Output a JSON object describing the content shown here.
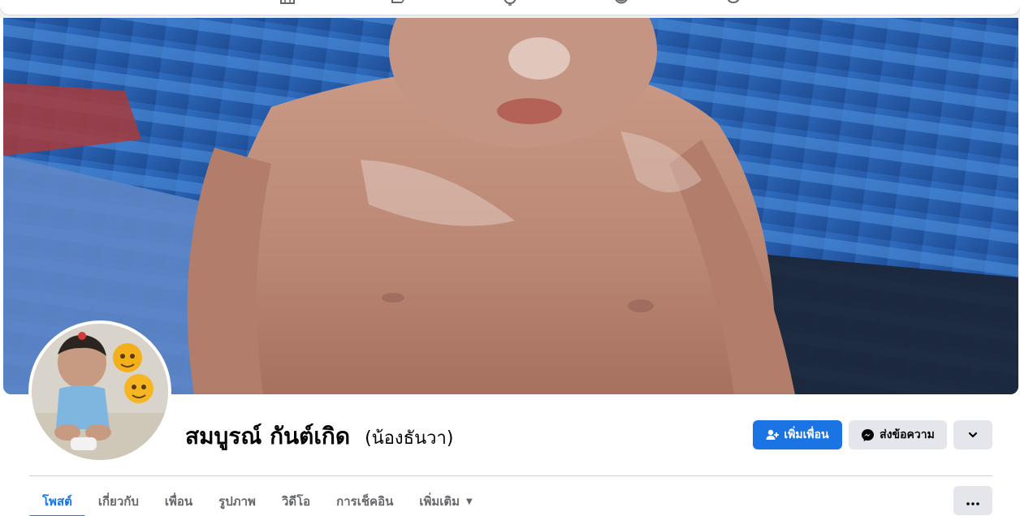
{
  "topnav": {
    "icons": [
      "home-icon",
      "pages-icon",
      "video-icon",
      "groups-icon",
      "gaming-icon"
    ]
  },
  "profile": {
    "name": "สมบูรณ์ กันต์เกิด",
    "nickname": "(น้องธันวา)",
    "cover_alt": "cover-photo",
    "avatar_alt": "profile-picture"
  },
  "actions": {
    "add_friend_label": "เพิ่มเพื่อน",
    "message_label": "ส่งข้อความ",
    "more_icon": "chevron-down-icon"
  },
  "tabs": [
    {
      "label": "โพสต์",
      "active": true
    },
    {
      "label": "เกี่ยวกับ",
      "active": false
    },
    {
      "label": "เพื่อน",
      "active": false
    },
    {
      "label": "รูปภาพ",
      "active": false
    },
    {
      "label": "วิดีโอ",
      "active": false
    },
    {
      "label": "การเช็คอิน",
      "active": false
    },
    {
      "label": "เพิ่มเติม",
      "active": false,
      "dropdown": true
    }
  ],
  "tabs_more_icon": "ellipsis-icon",
  "colors": {
    "accent": "#1b74e4",
    "secondary_button": "#e4e6eb",
    "muted_text": "#65676b",
    "divider": "#ced0d4"
  }
}
